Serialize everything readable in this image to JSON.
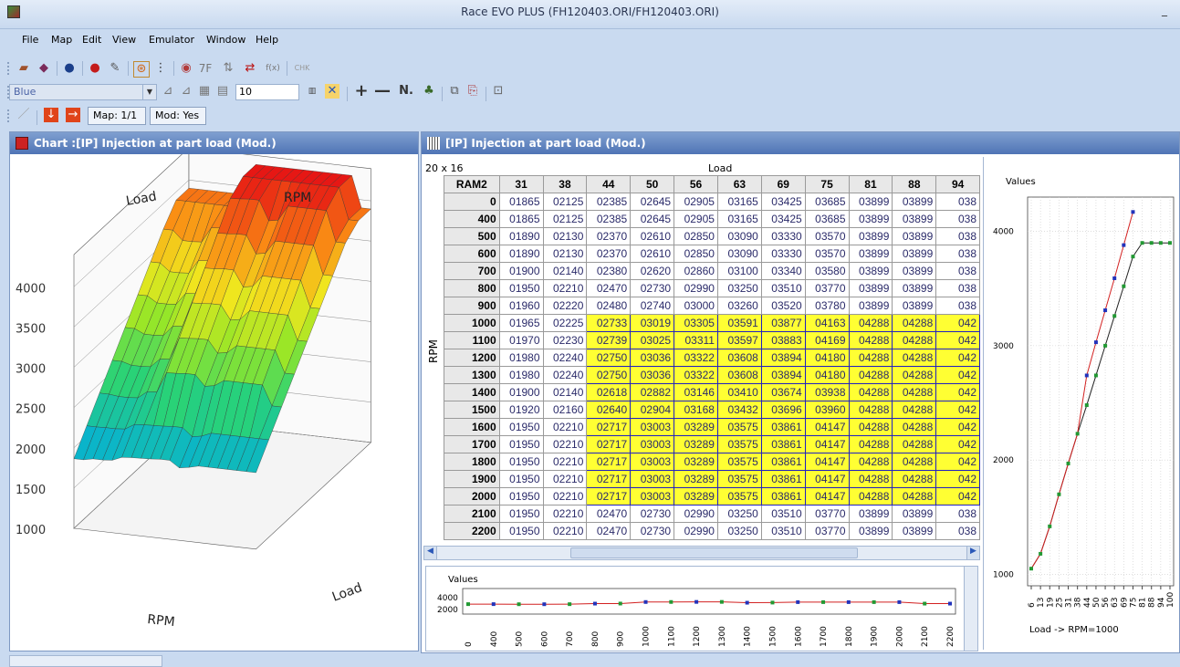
{
  "window": {
    "title": "Race EVO PLUS (FH120403.ORI/FH120403.ORI)",
    "minimize": "_"
  },
  "menu": [
    "File",
    "Map",
    "Edit",
    "View",
    "Emulator",
    "Window",
    "Help"
  ],
  "toolbar1": {
    "text_7f": "7F",
    "text_fx": "f(x)",
    "text_chk": "CHK"
  },
  "toolbar2": {
    "color_select": "Blue",
    "step_value": "10",
    "n_label": "N."
  },
  "toolbar3": {
    "map_box": "Map: 1/1",
    "mod_box": "Mod: Yes"
  },
  "chart_panel": {
    "title": "Chart :[IP] Injection at part load (Mod.)",
    "axis_load": "Load",
    "axis_rpm_top": "RPM",
    "axis_rpm_bottom": "RPM",
    "axis_load_bottom": "Load",
    "z_ticks": [
      "4000",
      "3500",
      "3000",
      "2500",
      "2000",
      "1500",
      "1000"
    ]
  },
  "grid_panel": {
    "title": "[IP] Injection at part load (Mod.)",
    "dims": "20 x 16",
    "load_label": "Load",
    "rpm_label": "RPM",
    "corner": "RAM2",
    "columns": [
      "31",
      "38",
      "44",
      "50",
      "56",
      "63",
      "69",
      "75",
      "81",
      "88",
      "94"
    ],
    "rows": [
      {
        "rpm": "0",
        "v": [
          "01865",
          "02125",
          "02385",
          "02645",
          "02905",
          "03165",
          "03425",
          "03685",
          "03899",
          "03899",
          "038"
        ]
      },
      {
        "rpm": "400",
        "v": [
          "01865",
          "02125",
          "02385",
          "02645",
          "02905",
          "03165",
          "03425",
          "03685",
          "03899",
          "03899",
          "038"
        ]
      },
      {
        "rpm": "500",
        "v": [
          "01890",
          "02130",
          "02370",
          "02610",
          "02850",
          "03090",
          "03330",
          "03570",
          "03899",
          "03899",
          "038"
        ]
      },
      {
        "rpm": "600",
        "v": [
          "01890",
          "02130",
          "02370",
          "02610",
          "02850",
          "03090",
          "03330",
          "03570",
          "03899",
          "03899",
          "038"
        ]
      },
      {
        "rpm": "700",
        "v": [
          "01900",
          "02140",
          "02380",
          "02620",
          "02860",
          "03100",
          "03340",
          "03580",
          "03899",
          "03899",
          "038"
        ]
      },
      {
        "rpm": "800",
        "v": [
          "01950",
          "02210",
          "02470",
          "02730",
          "02990",
          "03250",
          "03510",
          "03770",
          "03899",
          "03899",
          "038"
        ]
      },
      {
        "rpm": "900",
        "v": [
          "01960",
          "02220",
          "02480",
          "02740",
          "03000",
          "03260",
          "03520",
          "03780",
          "03899",
          "03899",
          "038"
        ]
      },
      {
        "rpm": "1000",
        "v": [
          "01965",
          "02225",
          "02733",
          "03019",
          "03305",
          "03591",
          "03877",
          "04163",
          "04288",
          "04288",
          "042"
        ]
      },
      {
        "rpm": "1100",
        "v": [
          "01970",
          "02230",
          "02739",
          "03025",
          "03311",
          "03597",
          "03883",
          "04169",
          "04288",
          "04288",
          "042"
        ]
      },
      {
        "rpm": "1200",
        "v": [
          "01980",
          "02240",
          "02750",
          "03036",
          "03322",
          "03608",
          "03894",
          "04180",
          "04288",
          "04288",
          "042"
        ]
      },
      {
        "rpm": "1300",
        "v": [
          "01980",
          "02240",
          "02750",
          "03036",
          "03322",
          "03608",
          "03894",
          "04180",
          "04288",
          "04288",
          "042"
        ]
      },
      {
        "rpm": "1400",
        "v": [
          "01900",
          "02140",
          "02618",
          "02882",
          "03146",
          "03410",
          "03674",
          "03938",
          "04288",
          "04288",
          "042"
        ]
      },
      {
        "rpm": "1500",
        "v": [
          "01920",
          "02160",
          "02640",
          "02904",
          "03168",
          "03432",
          "03696",
          "03960",
          "04288",
          "04288",
          "042"
        ]
      },
      {
        "rpm": "1600",
        "v": [
          "01950",
          "02210",
          "02717",
          "03003",
          "03289",
          "03575",
          "03861",
          "04147",
          "04288",
          "04288",
          "042"
        ]
      },
      {
        "rpm": "1700",
        "v": [
          "01950",
          "02210",
          "02717",
          "03003",
          "03289",
          "03575",
          "03861",
          "04147",
          "04288",
          "04288",
          "042"
        ]
      },
      {
        "rpm": "1800",
        "v": [
          "01950",
          "02210",
          "02717",
          "03003",
          "03289",
          "03575",
          "03861",
          "04147",
          "04288",
          "04288",
          "042"
        ]
      },
      {
        "rpm": "1900",
        "v": [
          "01950",
          "02210",
          "02717",
          "03003",
          "03289",
          "03575",
          "03861",
          "04147",
          "04288",
          "04288",
          "042"
        ]
      },
      {
        "rpm": "2000",
        "v": [
          "01950",
          "02210",
          "02717",
          "03003",
          "03289",
          "03575",
          "03861",
          "04147",
          "04288",
          "04288",
          "042"
        ]
      },
      {
        "rpm": "2100",
        "v": [
          "01950",
          "02210",
          "02470",
          "02730",
          "02990",
          "03250",
          "03510",
          "03770",
          "03899",
          "03899",
          "038"
        ]
      },
      {
        "rpm": "2200",
        "v": [
          "01950",
          "02210",
          "02470",
          "02730",
          "02990",
          "03250",
          "03510",
          "03770",
          "03899",
          "03899",
          "038"
        ]
      }
    ]
  },
  "bottom_chart": {
    "title": "Values",
    "y_ticks": [
      "4000",
      "2000"
    ],
    "x_labels": [
      "0",
      "400",
      "500",
      "600",
      "700",
      "800",
      "900",
      "1000",
      "1100",
      "1200",
      "1300",
      "1400",
      "1500",
      "1600",
      "1700",
      "1800",
      "1900",
      "2000",
      "2100",
      "2200"
    ]
  },
  "side_chart": {
    "title": "Values",
    "y_ticks": [
      "4000",
      "3000",
      "2000",
      "1000"
    ],
    "x_labels": [
      "6",
      "13",
      "19",
      "25",
      "31",
      "38",
      "44",
      "50",
      "56",
      "63",
      "69",
      "75",
      "81",
      "88",
      "94",
      "100"
    ],
    "xlabel": "Load -> RPM=1000"
  },
  "colors": {
    "selection": "#ffff33",
    "panel_title": "#5b7fbf",
    "series_red": "#d22020",
    "series_black": "#222222"
  }
}
